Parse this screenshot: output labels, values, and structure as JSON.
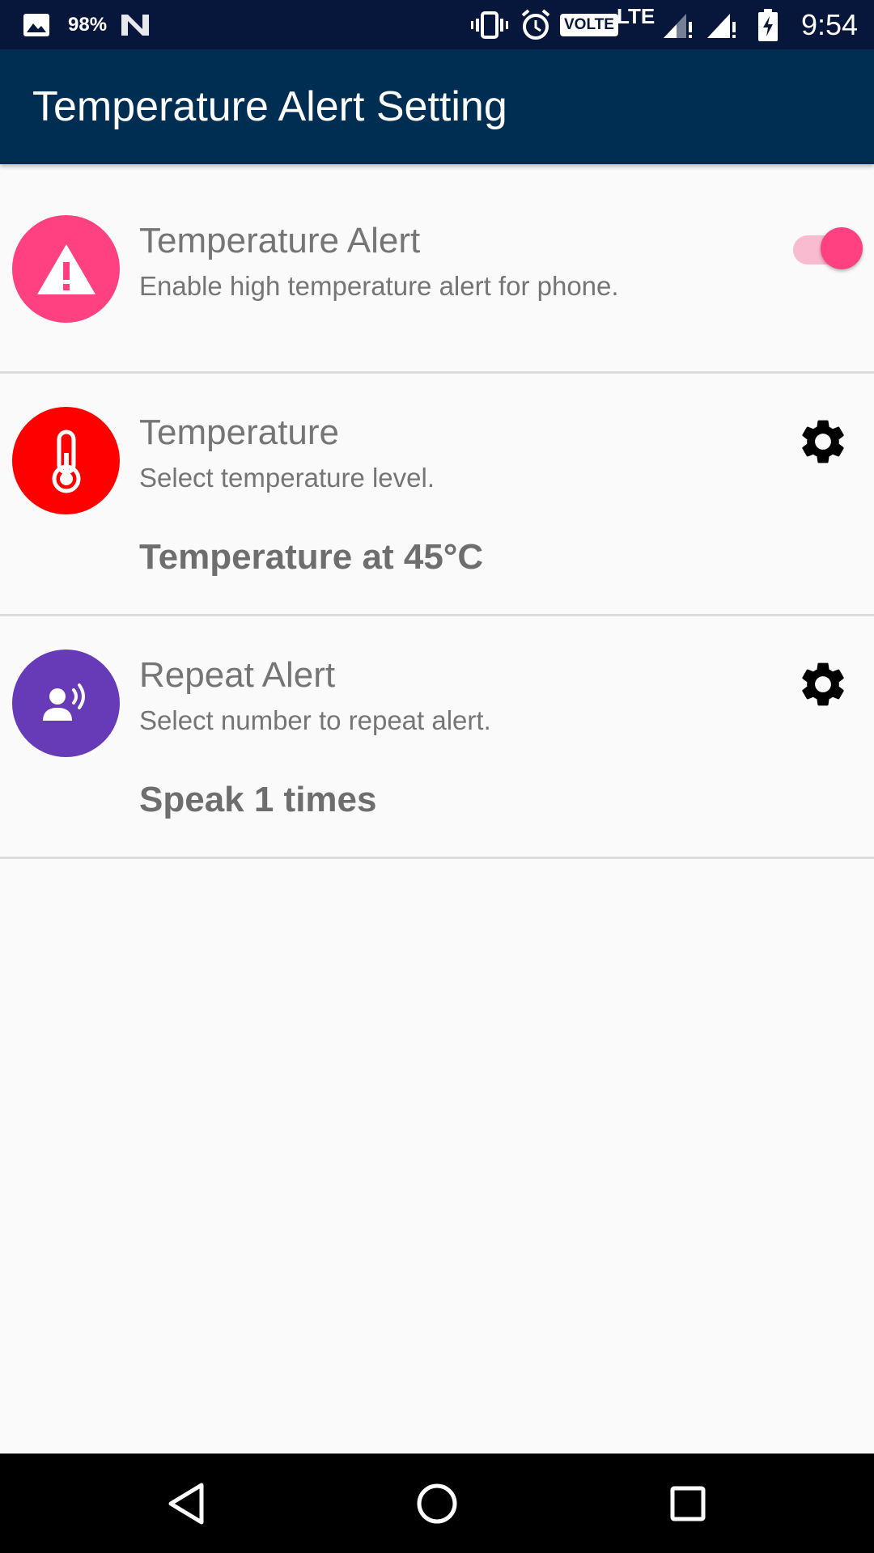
{
  "status_bar": {
    "battery_percent_text": "98%",
    "network_label": "LTE",
    "volte_label": "VOLTE",
    "time": "9:54",
    "icons": [
      "image-icon",
      "n-icon",
      "vibrate-icon",
      "alarm-icon",
      "volte-icon",
      "signal-icon",
      "signal-icon",
      "battery-charging-icon"
    ]
  },
  "app_bar": {
    "title": "Temperature Alert Setting",
    "color": "#002e53"
  },
  "settings": {
    "alert": {
      "title": "Temperature Alert",
      "subtitle": "Enable high temperature alert for phone.",
      "icon": "warning-icon",
      "icon_color": "#ff4081",
      "enabled": true
    },
    "temperature": {
      "title": "Temperature",
      "subtitle": "Select temperature level.",
      "value": "Temperature at 45°C",
      "icon": "thermometer-icon",
      "icon_color": "#ff0000",
      "action_icon": "gear-icon"
    },
    "repeat": {
      "title": "Repeat Alert",
      "subtitle": "Select number to repeat alert.",
      "value": "Speak 1 times",
      "icon": "speaker-person-icon",
      "icon_color": "#673ab7",
      "action_icon": "gear-icon"
    }
  },
  "colors": {
    "accent": "#ff4081",
    "toggle_track": "#f9bbd0"
  },
  "nav_bar": {
    "icons": [
      "back-icon",
      "home-icon",
      "recents-icon"
    ]
  }
}
